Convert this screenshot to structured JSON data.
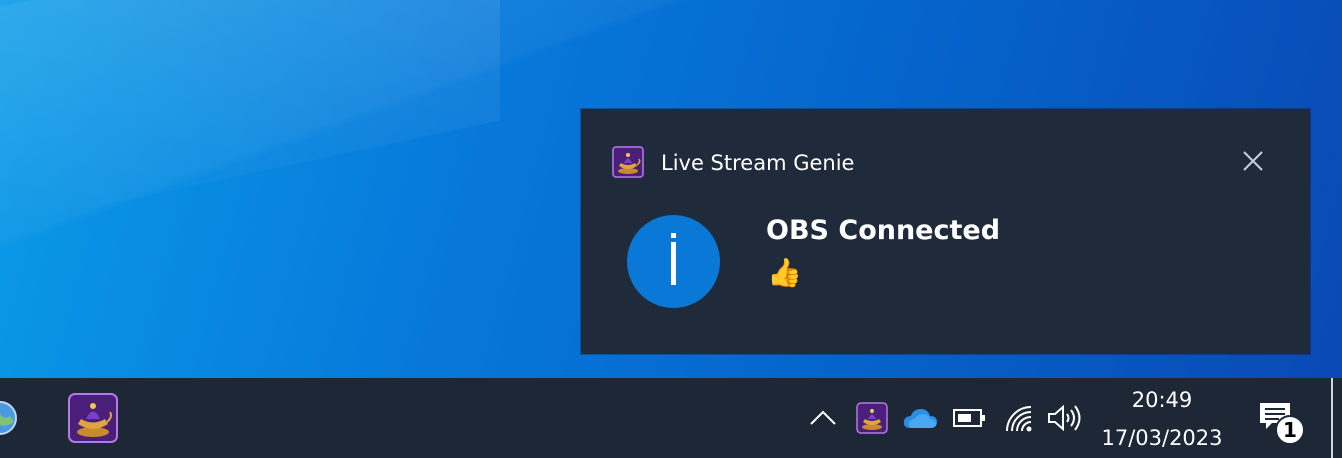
{
  "notification": {
    "app_name": "Live Stream Genie",
    "title": "OBS Connected",
    "body": "👍",
    "close_icon": "close-icon",
    "app_icon": "genie-lamp-icon",
    "hero_icon": "info-icon",
    "hero_letter": "i",
    "hero_color": "#0a78d6",
    "background": "#1f2b3b"
  },
  "taskbar": {
    "pinned": [
      {
        "icon": "globe-icon"
      },
      {
        "icon": "genie-lamp-icon"
      }
    ],
    "tray": {
      "overflow_icon": "chevron-up-icon",
      "icons": [
        "genie-lamp-icon",
        "onedrive-cloud-icon",
        "battery-icon",
        "wifi-icon",
        "volume-icon"
      ]
    },
    "clock": {
      "time": "20:49",
      "date": "17/03/2023"
    },
    "action_center": {
      "icon": "notification-icon",
      "badge": "1"
    },
    "background": "#1d2735"
  }
}
